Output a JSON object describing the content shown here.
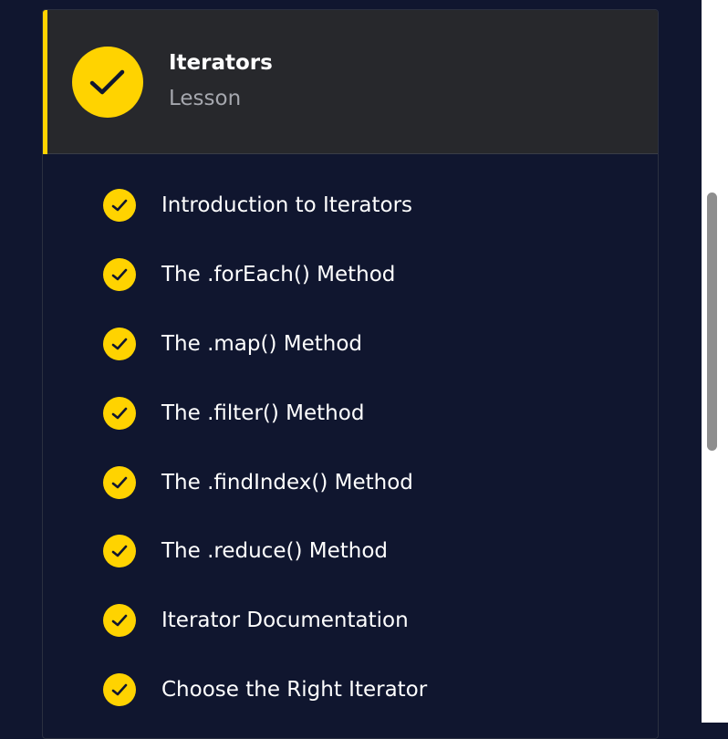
{
  "lesson": {
    "title": "Iterators",
    "subtitle": "Lesson",
    "status": "completed",
    "items": [
      {
        "label": "Introduction to Iterators",
        "completed": true
      },
      {
        "label": "The .forEach() Method",
        "completed": true
      },
      {
        "label": "The .map() Method",
        "completed": true
      },
      {
        "label": "The .filter() Method",
        "completed": true
      },
      {
        "label": "The .findIndex() Method",
        "completed": true
      },
      {
        "label": "The .reduce() Method",
        "completed": true
      },
      {
        "label": "Iterator Documentation",
        "completed": true
      },
      {
        "label": "Choose the Right Iterator",
        "completed": true
      }
    ]
  },
  "icons": {
    "header_status": "check-icon",
    "item_status": "check-icon"
  },
  "colors": {
    "background": "#10162f",
    "accent": "#ffd300",
    "header_background": "#27282c",
    "text": "#ffffff",
    "muted_text": "#a5a7ae"
  }
}
